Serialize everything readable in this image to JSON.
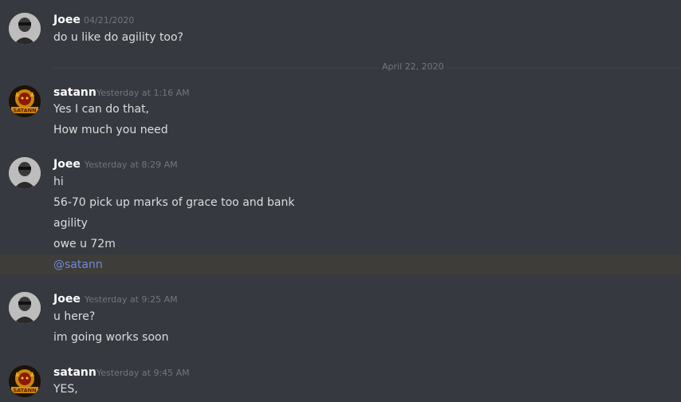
{
  "messages": [
    {
      "author": "Joee",
      "timestamp": "04/21/2020",
      "lines": [
        "do u like do agility too?"
      ]
    },
    {
      "author": "satann",
      "timestamp": "Yesterday at 1:16 AM",
      "lines": [
        "Yes I can do that,",
        "How much you need"
      ]
    },
    {
      "author": "Joee",
      "timestamp": "Yesterday at 8:29 AM",
      "lines": [
        "hi",
        "56-70 pick up marks of grace too and bank",
        "agility",
        "owe u 72m"
      ],
      "mention": "@satann"
    },
    {
      "author": "Joee",
      "timestamp": "Yesterday at 9:25 AM",
      "lines": [
        "u here?",
        "im going works soon"
      ]
    },
    {
      "author": "satann",
      "timestamp": "Yesterday at 9:45 AM",
      "lines": [
        "YES,"
      ]
    }
  ],
  "date_divider": "April 22, 2020",
  "avatar_badge_text": "SATANN",
  "colors": {
    "background": "#36393f",
    "username": "#ffffff",
    "timestamp": "#72767d",
    "message_text": "#dcddde",
    "mention_text": "#7289da",
    "mention_highlight": "#3f3d39"
  }
}
